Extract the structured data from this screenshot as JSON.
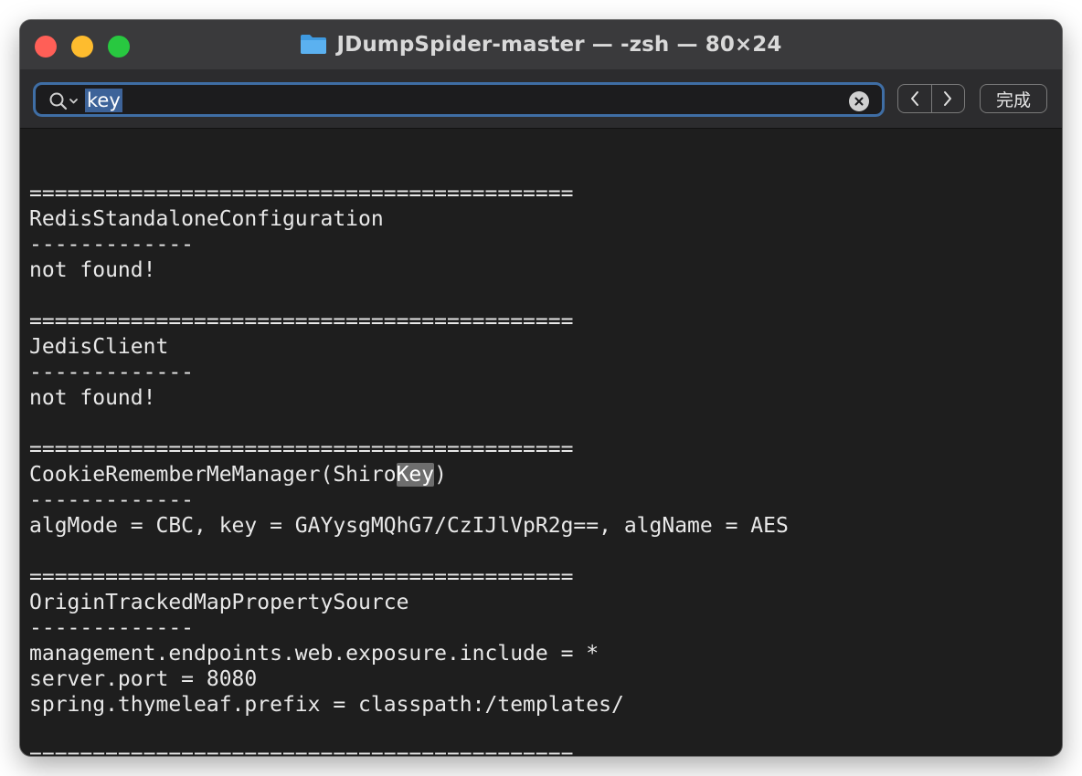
{
  "window": {
    "title": "JDumpSpider-master — -zsh — 80×24"
  },
  "search": {
    "query": "key",
    "done_label": "完成"
  },
  "terminal": {
    "lines": [
      "",
      "===========================================",
      "RedisStandaloneConfiguration",
      "-------------",
      "not found!",
      "",
      "===========================================",
      "JedisClient",
      "-------------",
      "not found!",
      "",
      "===========================================",
      "CookieRememberMeManager(ShiroKey)",
      "-------------",
      "algMode = CBC, key = GAYysgMQhG7/CzIJlVpR2g==, algName = AES",
      "",
      "===========================================",
      "OriginTrackedMapPropertySource",
      "-------------",
      "management.endpoints.web.exposure.include = *",
      "server.port = 8080",
      "spring.thymeleaf.prefix = classpath:/templates/",
      "",
      "==========================================="
    ],
    "highlight": {
      "line": 12,
      "before": "CookieRememberMeManager(Shiro",
      "match": "Key",
      "after": ")"
    }
  },
  "colors": {
    "close": "#ff5f57",
    "minimize": "#febc2e",
    "maximize": "#28c840",
    "focus_ring": "#3f6ea5",
    "search_selection": "#3d6399",
    "match_highlight": "#6e6e6e",
    "terminal_bg": "#1e1e1e"
  },
  "icons": {
    "folder": "folder-icon",
    "search": "magnifier-dropdown-icon",
    "clear": "clear-circle-icon",
    "prev": "chevron-left-icon",
    "next": "chevron-right-icon"
  }
}
